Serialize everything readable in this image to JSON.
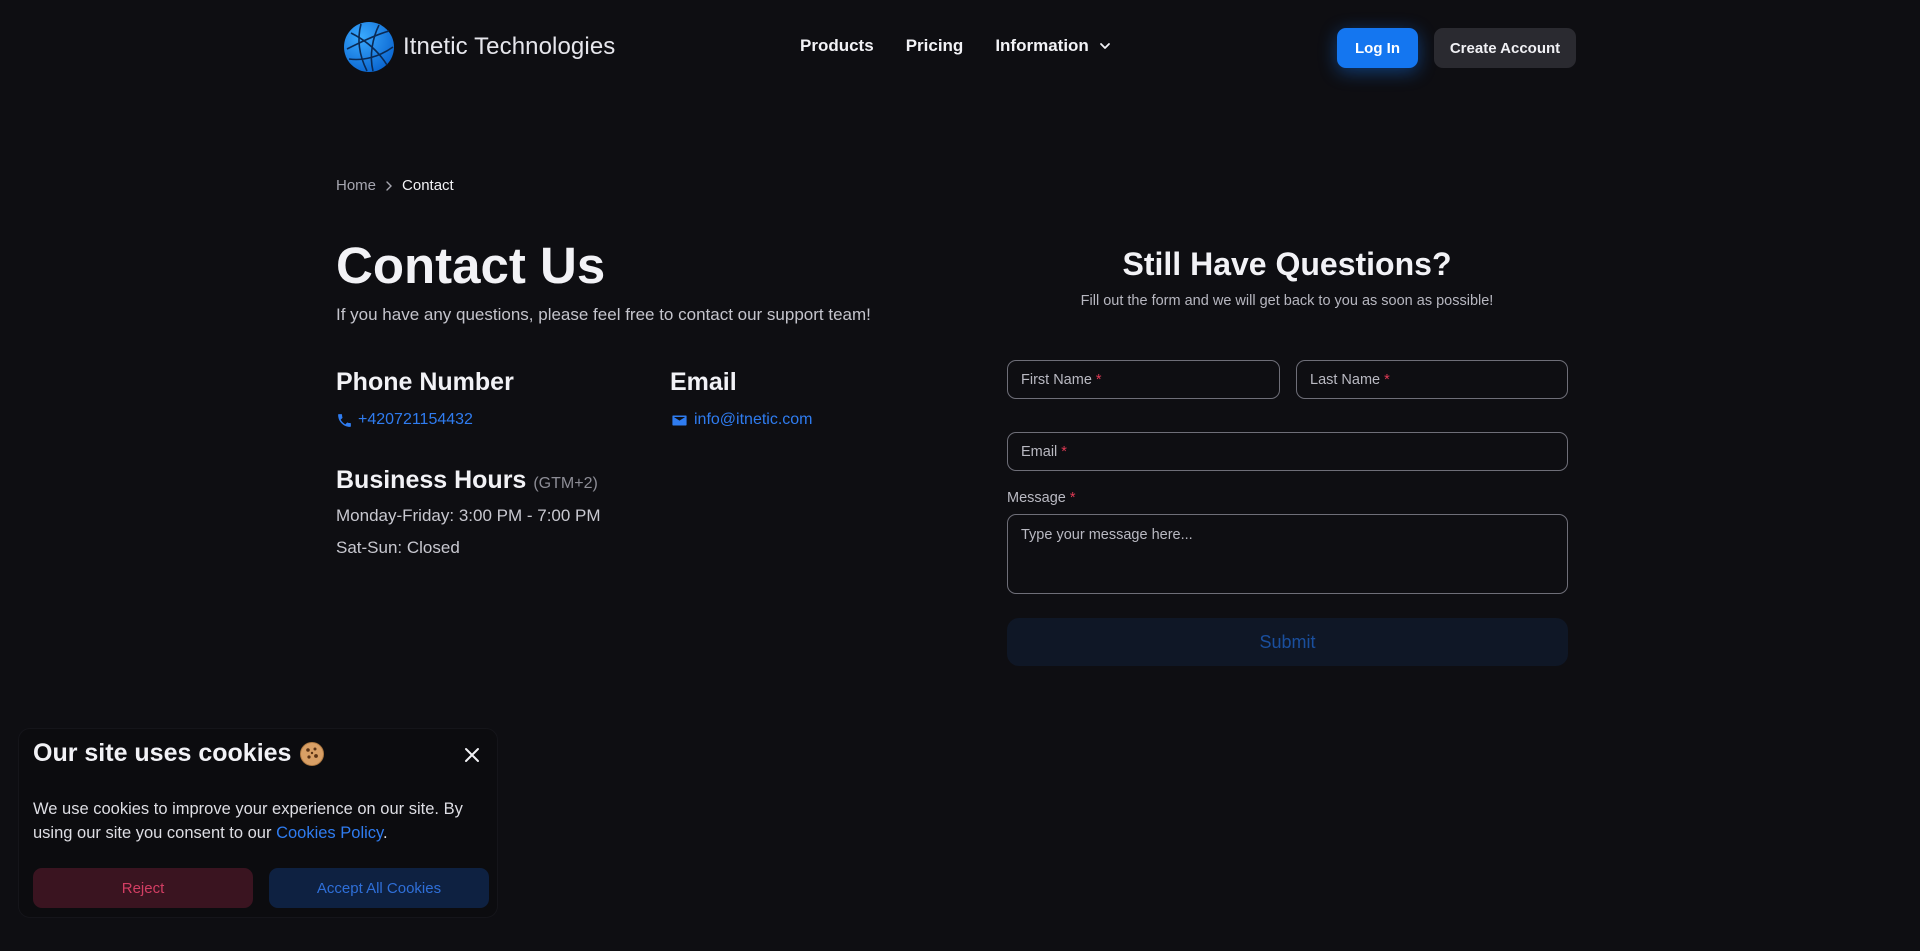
{
  "header": {
    "brand": "Itnetic Technologies",
    "nav": [
      {
        "label": "Products"
      },
      {
        "label": "Pricing"
      },
      {
        "label": "Information"
      }
    ],
    "login_label": "Log In",
    "create_label": "Create Account"
  },
  "breadcrumb": {
    "home": "Home",
    "current": "Contact"
  },
  "contact": {
    "title": "Contact Us",
    "subtitle": "If you have any questions, please feel free to contact our support team!",
    "phone_heading": "Phone Number",
    "phone": "+420721154432",
    "email_heading": "Email",
    "email": "info@itnetic.com",
    "hours_heading": "Business Hours",
    "timezone": "(GTM+2)",
    "hours_weekday": "Monday-Friday: 3:00 PM - 7:00 PM",
    "hours_weekend": "Sat-Sun: Closed"
  },
  "form": {
    "title": "Still Have Questions?",
    "subtitle": "Fill out the form and we will get back to you as soon as possible!",
    "first_name_placeholder": "First Name",
    "last_name_placeholder": "Last Name",
    "email_placeholder": "Email",
    "message_label": "Message",
    "message_placeholder": "Type your message here...",
    "required_mark": "*",
    "submit_label": "Submit"
  },
  "cookie": {
    "title": "Our site uses cookies",
    "text_before": "We use cookies to improve your experience on our site. By using our site you consent to our ",
    "link": "Cookies Policy",
    "text_after": ".",
    "reject_label": "Reject",
    "accept_label": "Accept All Cookies"
  },
  "colors": {
    "background": "#0e0e12",
    "accent": "#1476f0",
    "link": "#2f7cf0",
    "required": "#e03a55"
  },
  "icons": [
    "globe-logo-icon",
    "chevron-down-icon",
    "phone-icon",
    "mail-icon",
    "cookie-icon",
    "close-icon"
  ]
}
